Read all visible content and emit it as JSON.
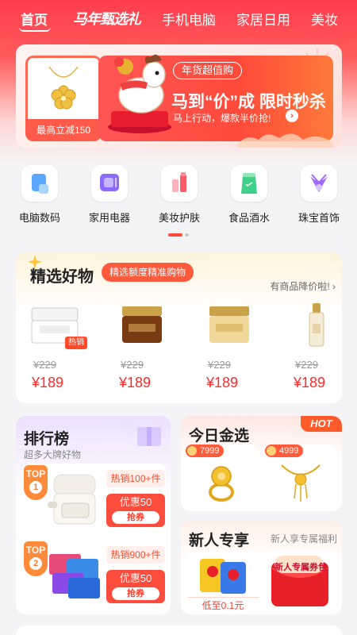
{
  "nav": {
    "items": [
      "首页",
      "马年甄选礼",
      "手机电脑",
      "家居日用",
      "美妆"
    ]
  },
  "banner": {
    "card_label": "最高立减150",
    "pill": "年货超值购",
    "title": "马到“价”成 限时秒杀",
    "subtitle": "马上行动，爆款半价抢!",
    "arrow_icon": "chevron-right-icon"
  },
  "categories": [
    {
      "label": "电脑数码",
      "icon": "computer-icon",
      "color": "#5aa8ff"
    },
    {
      "label": "家用电器",
      "icon": "appliance-icon",
      "color": "#8b6bff"
    },
    {
      "label": "美妆护肤",
      "icon": "cosmetics-icon",
      "color": "#ff5a6a"
    },
    {
      "label": "食品酒水",
      "icon": "drink-icon",
      "color": "#3fd18a"
    },
    {
      "label": "珠宝首饰",
      "icon": "jewelry-icon",
      "color": "#a06aff"
    }
  ],
  "selected_goods": {
    "title": "精选好物",
    "tag": "精选额度精准购物",
    "more": "有商品降价啦!",
    "products": [
      {
        "old_price": "¥229",
        "price": "¥189",
        "badge": "热销"
      },
      {
        "old_price": "¥229",
        "price": "¥189"
      },
      {
        "old_price": "¥229",
        "price": "¥189"
      },
      {
        "old_price": "¥229",
        "price": "¥189"
      }
    ]
  },
  "ranking": {
    "title": "排行榜",
    "subtitle": "超多大牌好物",
    "items": [
      {
        "badge_top": "TOP",
        "rank": "1",
        "hot": "热销100+件",
        "coupon": "优惠50",
        "button": "抢券"
      },
      {
        "badge_top": "TOP",
        "rank": "2",
        "hot": "热销900+件",
        "coupon": "优惠50",
        "button": "抢券"
      }
    ]
  },
  "today_gold": {
    "title": "今日金选",
    "hot": "HOT",
    "items": [
      {
        "price": "7999"
      },
      {
        "price": "4999"
      }
    ]
  },
  "new_user": {
    "title": "新人专享",
    "subtitle": "新人享专属福利",
    "low": "低至0.1元",
    "coupon_label": "新人专属券包"
  },
  "colors": {
    "brand_red": "#ff3d4d",
    "price_red": "#ff2a2a",
    "accent_orange": "#ff5a3c"
  }
}
